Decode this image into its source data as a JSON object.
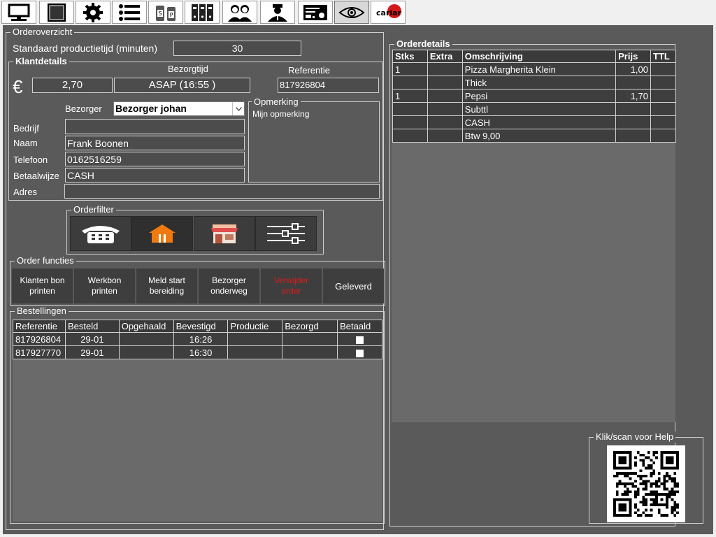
{
  "toolbar": {
    "buttons": [
      {
        "icon": "monitor-icon"
      },
      {
        "icon": "tablet-icon"
      },
      {
        "icon": "gear-icon"
      },
      {
        "icon": "list-icon"
      },
      {
        "icon": "sp-icon"
      },
      {
        "icon": "binders-icon"
      },
      {
        "icon": "users-icon"
      },
      {
        "icon": "driver-icon"
      },
      {
        "icon": "report-icon"
      },
      {
        "icon": "eye-icon"
      },
      {
        "icon": "cariari-logo"
      }
    ],
    "logo_text": "cariari"
  },
  "orderoverzicht": {
    "legend": "Orderoverzicht",
    "std_label": "Standaard productietijd (minuten)",
    "std_value": "30"
  },
  "klantdetails": {
    "legend": "Klantdetails",
    "bezorgtijd_label": "Bezorgtijd",
    "referentie_label": "Referentie",
    "currency": "€",
    "amount": "2,70",
    "bezorgtijd": "ASAP (16:55 )",
    "referentie": "817926804",
    "bezorger_label": "Bezorger",
    "bezorger_value": "Bezorger johan",
    "opmerking_legend": "Opmerking",
    "opmerking_value": "Mijn opmerking",
    "bedrijf_label": "Bedrijf",
    "bedrijf_value": "",
    "naam_label": "Naam",
    "naam_value": "Frank Boonen",
    "telefoon_label": "Telefoon",
    "telefoon_value": "0162516259",
    "betaalwijze_label": "Betaalwijze",
    "betaalwijze_value": "CASH",
    "adres_label": "Adres",
    "adres_value": ""
  },
  "orderfilter": {
    "legend": "Orderfilter",
    "buttons": [
      "phone-icon",
      "delivery-house-icon",
      "shop-icon",
      "sliders-icon"
    ]
  },
  "order_functies": {
    "legend": "Order functies",
    "buttons": [
      {
        "l1": "Klanten bon",
        "l2": "printen"
      },
      {
        "l1": "Werkbon",
        "l2": "printen"
      },
      {
        "l1": "Meld start",
        "l2": "bereiding"
      },
      {
        "l1": "Bezorger",
        "l2": "onderweg"
      },
      {
        "l1": "Verwijder",
        "l2": "order"
      },
      {
        "l1": "Geleverd",
        "l2": ""
      }
    ]
  },
  "bestellingen": {
    "legend": "Bestellingen",
    "columns": [
      "Referentie",
      "Besteld",
      "Opgehaald",
      "Bevestigd",
      "Productie",
      "Bezorgd",
      "Betaald"
    ],
    "rows": [
      {
        "ref": "817926804",
        "besteld": "29-01",
        "opgehaald": "",
        "bevestigd": "16:26",
        "productie": "",
        "bezorgd": "",
        "betaald": true
      },
      {
        "ref": "817927770",
        "besteld": "29-01",
        "opgehaald": "",
        "bevestigd": "16:30",
        "productie": "",
        "bezorgd": "",
        "betaald": true
      }
    ]
  },
  "orderdetails": {
    "legend": "Orderdetails",
    "columns": [
      "Stks",
      "Extra",
      "Omschrijving",
      "Prijs",
      "TTL"
    ],
    "rows": [
      {
        "stks": "1",
        "extra": "",
        "oms": "Pizza Margherita Klein",
        "prijs": "1,00",
        "ttl": ""
      },
      {
        "stks": "",
        "extra": "",
        "oms": "Thick",
        "prijs": "",
        "ttl": ""
      },
      {
        "stks": "1",
        "extra": "",
        "oms": "Pepsi",
        "prijs": "1,70",
        "ttl": ""
      },
      {
        "stks": "",
        "extra": "",
        "oms": "Subttl",
        "prijs": "",
        "ttl": ""
      },
      {
        "stks": "",
        "extra": "",
        "oms": "CASH",
        "prijs": "",
        "ttl": ""
      },
      {
        "stks": "",
        "extra": "",
        "oms": "Btw 9,00",
        "prijs": "",
        "ttl": ""
      }
    ]
  },
  "help": {
    "legend": "Klik/scan voor Help"
  }
}
